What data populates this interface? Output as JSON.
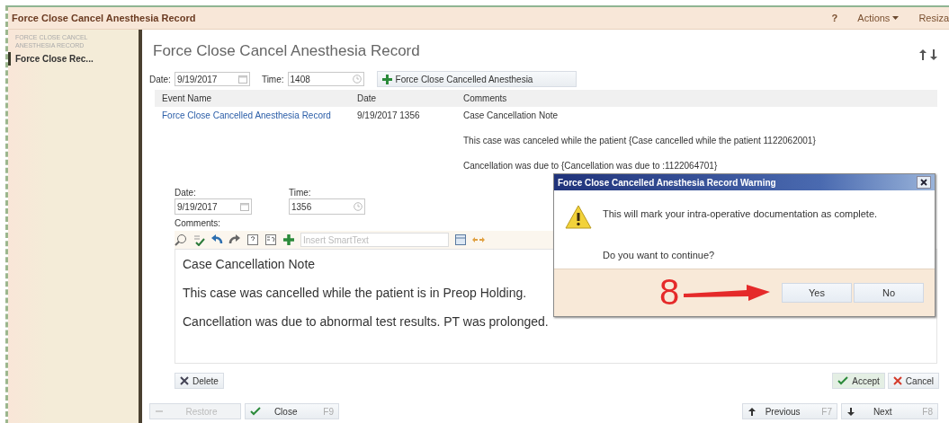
{
  "window": {
    "title": "Force Close Cancel Anesthesia Record",
    "menu": [
      {
        "kind": "help",
        "label": "?"
      },
      {
        "kind": "dropdown",
        "label": "Actions"
      },
      {
        "kind": "plain",
        "label": "Resiza"
      }
    ]
  },
  "sidebar": {
    "heading": "FORCE CLOSE CANCEL ANESTHESIA RECORD",
    "items": [
      {
        "label": "Force Close Rec...",
        "selected": true
      }
    ]
  },
  "form": {
    "title": "Force Close Cancel Anesthesia Record",
    "date_label": "Date:",
    "date": "9/19/2017",
    "time_label": "Time:",
    "time": "1408",
    "add_button": "Force Close Cancelled Anesthesia"
  },
  "table": {
    "columns": [
      "Event Name",
      "Date",
      "Comments"
    ],
    "rows": [
      {
        "event": "Force Close Cancelled Anesthesia Record",
        "date": "9/19/2017 1356",
        "comments": [
          "Case Cancellation Note",
          "This case was canceled while the patient {Case cancelled while the patient 1122062001}",
          "Cancellation was due to {Cancellation was due to :1122064701}"
        ]
      }
    ]
  },
  "editor": {
    "date_label": "Date:",
    "date": "9/19/2017",
    "time_label": "Time:",
    "time": "1356",
    "comments_label": "Comments:",
    "smarttext_placeholder": "Insert SmartText",
    "lines": [
      "Case Cancellation Note",
      "This case was cancelled while the patient is in Preop Holding.",
      "Cancellation was due to abnormal test results. PT was prolonged."
    ],
    "delete": "Delete",
    "accept": "Accept",
    "cancel": "Cancel"
  },
  "footer": {
    "buttons": [
      {
        "label": "Restore",
        "disabled": true
      },
      {
        "label": "Close",
        "shortcut": "F9",
        "disabled": false
      }
    ],
    "nav": [
      {
        "kind": "up",
        "label": "Previous",
        "shortcut": "F7"
      },
      {
        "kind": "down",
        "label": "Next",
        "shortcut": "F8"
      }
    ]
  },
  "dialog": {
    "title": "Force Close Cancelled Anesthesia Record Warning",
    "message": "This will mark your intra-operative documentation as complete.",
    "question": "Do you want to continue?",
    "buttons": [
      {
        "label": "Yes"
      },
      {
        "label": "No"
      }
    ]
  },
  "annotation": {
    "step": "8"
  }
}
